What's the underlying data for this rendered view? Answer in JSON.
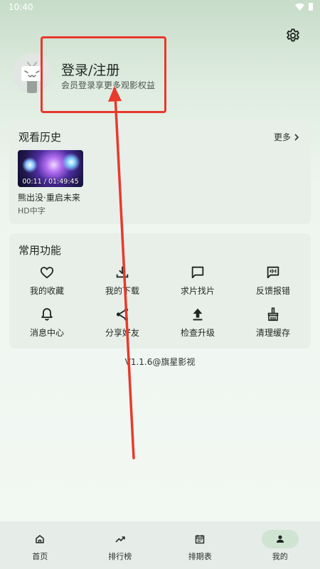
{
  "status_bar": {
    "time": "10:40"
  },
  "profile": {
    "login_title": "登录/注册",
    "login_subtitle": "会员登录享更多观影权益"
  },
  "history": {
    "title": "观看历史",
    "more_label": "更多",
    "items": [
      {
        "title": "熊出没·重启未来",
        "subtitle": "HD中字",
        "duration": "00:11 / 01:49:45"
      }
    ]
  },
  "functions": {
    "title": "常用功能",
    "items": [
      {
        "label": "我的收藏",
        "icon": "heart-icon"
      },
      {
        "label": "我的下载",
        "icon": "download-icon"
      },
      {
        "label": "求片找片",
        "icon": "chat-icon"
      },
      {
        "label": "反馈报错",
        "icon": "feedback-icon"
      },
      {
        "label": "消息中心",
        "icon": "bell-icon"
      },
      {
        "label": "分享好友",
        "icon": "share-icon"
      },
      {
        "label": "检查升级",
        "icon": "upgrade-icon"
      },
      {
        "label": "清理缓存",
        "icon": "broom-icon"
      }
    ]
  },
  "version_text": "V1.1.6@旗星影视",
  "bottom_nav": {
    "items": [
      {
        "label": "首页",
        "icon": "home-icon"
      },
      {
        "label": "排行榜",
        "icon": "trending-icon"
      },
      {
        "label": "排期表",
        "icon": "calendar-icon"
      },
      {
        "label": "我的",
        "icon": "person-icon",
        "active": true
      }
    ]
  },
  "colors": {
    "annotation": "#e8392d",
    "card_bg": "#e8efe9",
    "nav_active": "#cfe4d2"
  }
}
